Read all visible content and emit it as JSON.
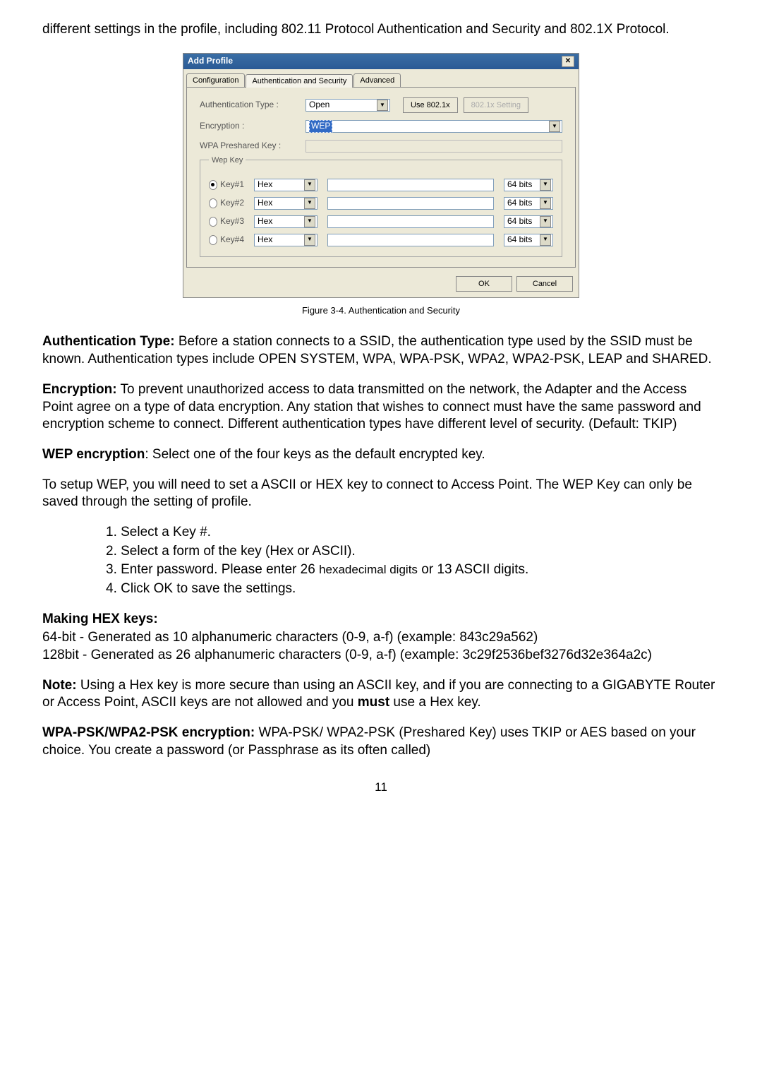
{
  "intro": "different settings in the profile, including 802.11 Protocol Authentication and Security and 802.1X Protocol.",
  "dialog": {
    "title": "Add Profile",
    "tabs": {
      "config": "Configuration",
      "authsec": "Authentication and Security",
      "advanced": "Advanced"
    },
    "auth_type_label": "Authentication Type :",
    "auth_type_value": "Open",
    "use8021x": "Use 802.1x",
    "setting8021x": "802.1x Setting",
    "encryption_label": "Encryption :",
    "encryption_value": "WEP",
    "wpa_psk_label": "WPA Preshared Key :",
    "wep_legend": "Wep Key",
    "keys": [
      {
        "label": "Key#1",
        "format": "Hex",
        "bits": "64 bits",
        "checked": true
      },
      {
        "label": "Key#2",
        "format": "Hex",
        "bits": "64 bits",
        "checked": false
      },
      {
        "label": "Key#3",
        "format": "Hex",
        "bits": "64 bits",
        "checked": false
      },
      {
        "label": "Key#4",
        "format": "Hex",
        "bits": "64 bits",
        "checked": false
      }
    ],
    "ok": "OK",
    "cancel": "Cancel"
  },
  "figcap": "Figure 3-4.   Authentication and Security",
  "para_auth_title": "Authentication Type:",
  "para_auth_body": " Before a station connects to a SSID, the authentication type used by the SSID must be known. Authentication types include OPEN SYSTEM, WPA, WPA-PSK, WPA2, WPA2-PSK, LEAP and SHARED.",
  "para_enc_title": "Encryption:",
  "para_enc_body": " To prevent unauthorized access to data transmitted on the network, the Adapter and the Access Point agree on a type of data encryption. Any station that wishes to connect must have the same password and encryption scheme to connect. Different authentication types have different level of security. (Default: TKIP)",
  "para_wep_title": "WEP encryption",
  "para_wep_body": ": Select one of the four keys as the default encrypted key.",
  "para_setup": "To setup WEP, you will need to set a ASCII or HEX key to connect to Access Point. The WEP Key can only be saved through the setting of profile.",
  "steps": {
    "s1": "1. Select a Key #.",
    "s2": "2. Select a form of the key (Hex or ASCII).",
    "s3a": "3. Enter password. Please enter 26 ",
    "s3b": "hexadecimal digits",
    "s3c": " or 13 ASCII digits.",
    "s4": "4. Click OK to save the settings."
  },
  "hex_title": "Making HEX keys:",
  "hex_l1": "64-bit - Generated as 10 alphanumeric characters (0-9, a-f) (example: 843c29a562)",
  "hex_l2": "128bit - Generated as 26 alphanumeric characters (0-9, a-f) (example: 3c29f2536bef3276d32e364a2c)",
  "note_title": "Note:",
  "note_a": " Using a Hex key is more secure than using an ASCII key, and if you are connecting to a GIGABYTE Router or Access Point, ASCII keys are not allowed and you ",
  "note_must": "must",
  "note_b": " use a Hex key.",
  "wpapsk_title": "WPA-PSK/WPA2-PSK encryption:",
  "wpapsk_body": " WPA-PSK/ WPA2-PSK (Preshared Key) uses TKIP or AES based on your choice.   You create a password (or Passphrase as its often called)",
  "pagenum": "11"
}
